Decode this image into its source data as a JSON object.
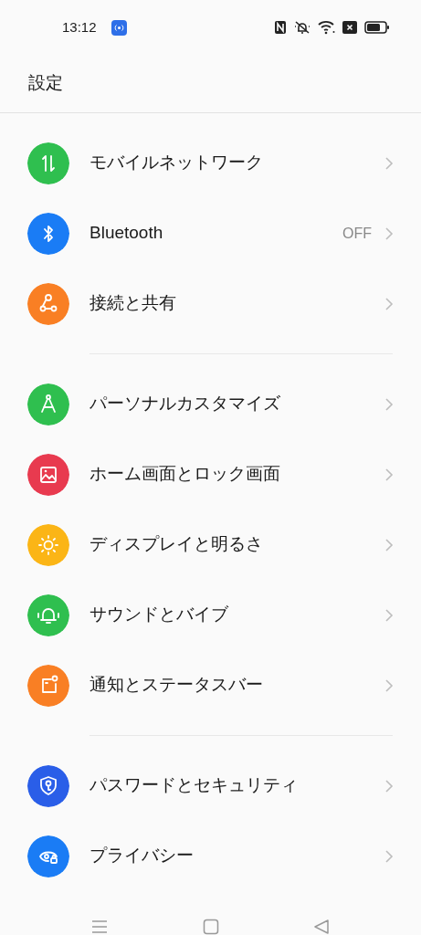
{
  "status_bar": {
    "time": "13:12"
  },
  "header": {
    "title": "設定"
  },
  "sections": [
    {
      "items": [
        {
          "label": "モバイルネットワーク",
          "color": "#2fbf4f"
        },
        {
          "label": "Bluetooth",
          "value": "OFF",
          "color": "#1a7cf5"
        },
        {
          "label": "接続と共有",
          "color": "#f97f24"
        }
      ]
    },
    {
      "items": [
        {
          "label": "パーソナルカスタマイズ",
          "color": "#2fbf4f"
        },
        {
          "label": "ホーム画面とロック画面",
          "color": "#e83a4f"
        },
        {
          "label": "ディスプレイと明るさ",
          "color": "#fbb516"
        },
        {
          "label": "サウンドとバイブ",
          "color": "#2fbf4f"
        },
        {
          "label": "通知とステータスバー",
          "color": "#f97f24"
        }
      ]
    },
    {
      "items": [
        {
          "label": "パスワードとセキュリティ",
          "color": "#2a5ee8"
        },
        {
          "label": "プライバシー",
          "color": "#1a7cf5"
        }
      ]
    }
  ]
}
